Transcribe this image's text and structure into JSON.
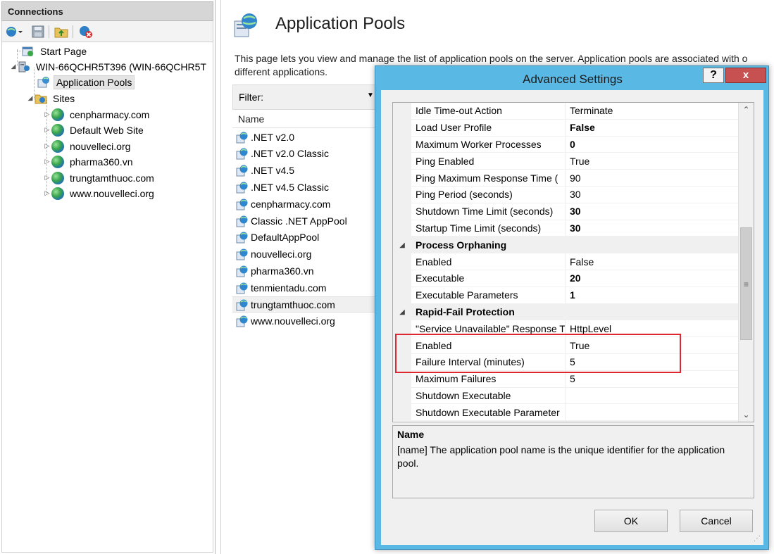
{
  "connections": {
    "header": "Connections",
    "toolbar": [
      "connect-icon",
      "save-icon",
      "folder-up-icon",
      "disconnect-icon"
    ],
    "tree": [
      {
        "label": "Start Page",
        "icon": "start-page-icon"
      },
      {
        "label": "WIN-66QCHR5T396 (WIN-66QCHR5T",
        "icon": "server-icon"
      },
      {
        "label": "Application Pools",
        "icon": "app-pools-icon",
        "selected": true
      },
      {
        "label": "Sites",
        "icon": "sites-folder-icon"
      },
      {
        "label": "cenpharmacy.com",
        "icon": "globe-icon"
      },
      {
        "label": "Default Web Site",
        "icon": "globe-icon"
      },
      {
        "label": "nouvelleci.org",
        "icon": "globe-icon"
      },
      {
        "label": "pharma360.vn",
        "icon": "globe-icon"
      },
      {
        "label": "trungtamthuoc.com",
        "icon": "globe-icon"
      },
      {
        "label": "www.nouvelleci.org",
        "icon": "globe-icon"
      }
    ]
  },
  "main": {
    "title": "Application Pools",
    "description_line1": "This page lets you view and manage the list of application pools on the server. Application pools are associated with o",
    "description_line2": "different applications.",
    "filter_label": "Filter:",
    "column_name": "Name",
    "pools": [
      ".NET v2.0",
      ".NET v2.0 Classic",
      ".NET v4.5",
      ".NET v4.5 Classic",
      "cenpharmacy.com",
      "Classic .NET AppPool",
      "DefaultAppPool",
      "nouvelleci.org",
      "pharma360.vn",
      "tenmientadu.com",
      "trungtamthuoc.com",
      "www.nouvelleci.org"
    ],
    "selected_pool": "trungtamthuoc.com"
  },
  "dialog": {
    "title": "Advanced Settings",
    "help_label": "?",
    "close_label": "x",
    "properties": [
      {
        "name": "Idle Time-out Action",
        "value": "Terminate"
      },
      {
        "name": "Load User Profile",
        "value": "False",
        "bold": true
      },
      {
        "name": "Maximum Worker Processes",
        "value": "0",
        "bold": true
      },
      {
        "name": "Ping Enabled",
        "value": "True"
      },
      {
        "name": "Ping Maximum Response Time (",
        "value": "90"
      },
      {
        "name": "Ping Period (seconds)",
        "value": "30"
      },
      {
        "name": "Shutdown Time Limit (seconds)",
        "value": "30",
        "bold": true
      },
      {
        "name": "Startup Time Limit (seconds)",
        "value": "30",
        "bold": true
      },
      {
        "category": "Process Orphaning"
      },
      {
        "name": "Enabled",
        "value": "False"
      },
      {
        "name": "Executable",
        "value": "20",
        "bold": true
      },
      {
        "name": "Executable Parameters",
        "value": "1",
        "bold": true
      },
      {
        "category": "Rapid-Fail Protection"
      },
      {
        "name": "\"Service Unavailable\" Response T",
        "value": "HttpLevel"
      },
      {
        "name": "Enabled",
        "value": "True"
      },
      {
        "name": "Failure Interval (minutes)",
        "value": "5"
      },
      {
        "name": "Maximum Failures",
        "value": "5"
      },
      {
        "name": "Shutdown Executable",
        "value": ""
      },
      {
        "name": "Shutdown Executable Parameter",
        "value": ""
      }
    ],
    "desc_title": "Name",
    "desc_text": "[name] The application pool name is the unique identifier for the application pool.",
    "ok_label": "OK",
    "cancel_label": "Cancel"
  }
}
